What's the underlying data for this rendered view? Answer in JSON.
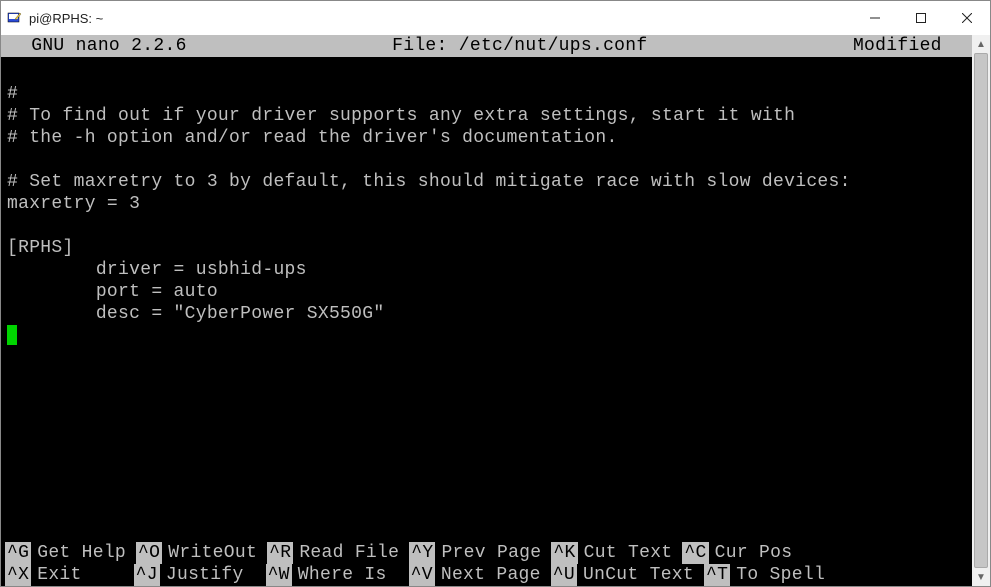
{
  "window": {
    "title": "pi@RPHS: ~"
  },
  "nano": {
    "app": "GNU nano",
    "version": "2.2.6",
    "file_label": "File:",
    "file_path": "/etc/nut/ups.conf",
    "status": "Modified"
  },
  "content": {
    "lines": [
      "#",
      "# To find out if your driver supports any extra settings, start it with",
      "# the -h option and/or read the driver's documentation.",
      "",
      "# Set maxretry to 3 by default, this should mitigate race with slow devices:",
      "maxretry = 3",
      "",
      "[RPHS]",
      "        driver = usbhid-ups",
      "        port = auto",
      "        desc = \"CyberPower SX550G\""
    ]
  },
  "shortcuts": {
    "row1": [
      {
        "key": "^G",
        "label": "Get Help"
      },
      {
        "key": "^O",
        "label": "WriteOut"
      },
      {
        "key": "^R",
        "label": "Read File"
      },
      {
        "key": "^Y",
        "label": "Prev Page"
      },
      {
        "key": "^K",
        "label": "Cut Text"
      },
      {
        "key": "^C",
        "label": "Cur Pos"
      }
    ],
    "row2": [
      {
        "key": "^X",
        "label": "Exit"
      },
      {
        "key": "^J",
        "label": "Justify"
      },
      {
        "key": "^W",
        "label": "Where Is"
      },
      {
        "key": "^V",
        "label": "Next Page"
      },
      {
        "key": "^U",
        "label": "UnCut Text"
      },
      {
        "key": "^T",
        "label": "To Spell"
      }
    ]
  }
}
